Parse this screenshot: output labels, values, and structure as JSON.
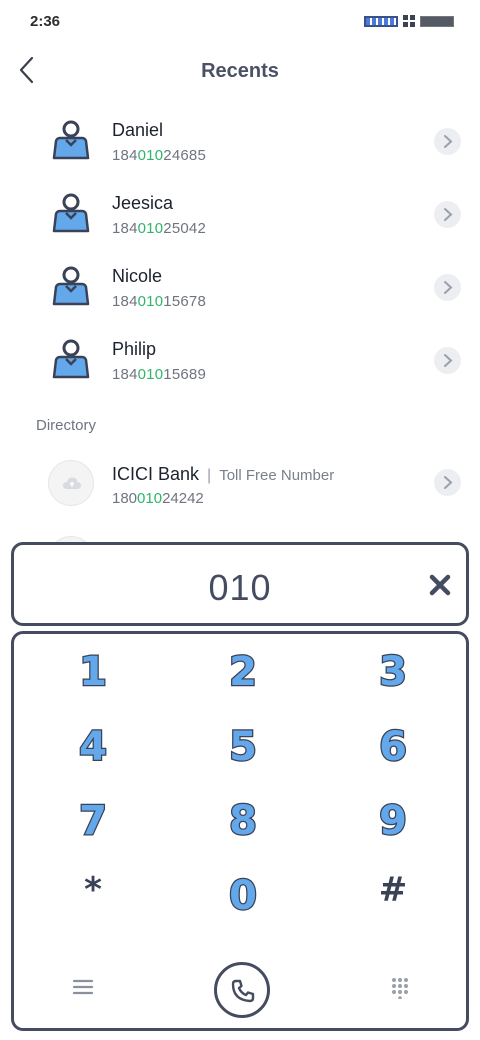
{
  "status": {
    "time": "2:36"
  },
  "header": {
    "title": "Recents"
  },
  "recents": [
    {
      "name": "Daniel",
      "number_pre": "184",
      "number_hl": "010",
      "number_post": "24685"
    },
    {
      "name": "Jeesica",
      "number_pre": "184",
      "number_hl": "010",
      "number_post": "25042"
    },
    {
      "name": "Nicole",
      "number_pre": "184",
      "number_hl": "010",
      "number_post": "15678"
    },
    {
      "name": "Philip",
      "number_pre": "184",
      "number_hl": "010",
      "number_post": "15689"
    }
  ],
  "directory": {
    "label": "Directory",
    "items": [
      {
        "name": "ICICI Bank",
        "tag": "Toll Free Number",
        "number_pre": "180",
        "number_hl": "010",
        "number_post": "24242"
      }
    ]
  },
  "dialer": {
    "value": "010",
    "keys": [
      "1",
      "2",
      "3",
      "4",
      "5",
      "6",
      "7",
      "8",
      "9",
      "*",
      "0",
      "#"
    ]
  },
  "icons": {
    "back": "chevron-left-icon",
    "contact": "person-icon",
    "directory": "cloud-icon",
    "clear": "close-icon",
    "menu": "hamburger-icon",
    "call": "phone-icon",
    "keypad": "dialpad-icon"
  },
  "colors": {
    "accent": "#63a8ea",
    "highlight": "#2fb56b",
    "outline": "#454c61"
  }
}
